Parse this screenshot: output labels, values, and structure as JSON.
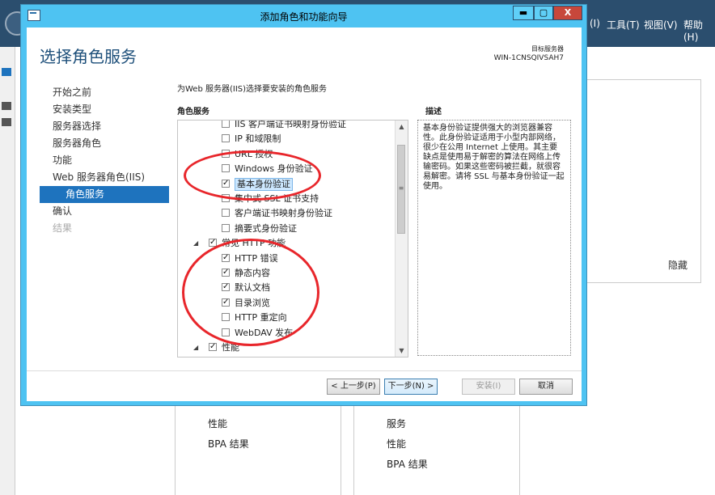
{
  "background": {
    "menu": [
      "(I)",
      "工具(T)",
      "视图(V)",
      "帮助(H)"
    ],
    "hide_label": "隐藏",
    "card1": [
      "性能",
      "BPA 结果"
    ],
    "card2": [
      "服务",
      "性能",
      "BPA 结果"
    ]
  },
  "dialog": {
    "title": "添加角色和功能向导",
    "minimize": "▬",
    "maximize": "▢",
    "close": "X",
    "page_title": "选择角色服务",
    "target_label": "目标服务器",
    "target_name": "WIN-1CNSQIVSAH7",
    "nav": [
      {
        "label": "开始之前",
        "state": "normal"
      },
      {
        "label": "安装类型",
        "state": "normal"
      },
      {
        "label": "服务器选择",
        "state": "normal"
      },
      {
        "label": "服务器角色",
        "state": "normal"
      },
      {
        "label": "功能",
        "state": "normal"
      },
      {
        "label": "Web 服务器角色(IIS)",
        "state": "normal"
      },
      {
        "label": "角色服务",
        "state": "active"
      },
      {
        "label": "确认",
        "state": "normal"
      },
      {
        "label": "结果",
        "state": "disabled"
      }
    ],
    "instruction": "为Web 服务器(IIS)选择要安装的角色服务",
    "roles_header": "角色服务",
    "desc_header": "描述",
    "tree": [
      {
        "label": "IIS 客户端证书映射身份验证",
        "checked": false,
        "indent": 2
      },
      {
        "label": "IP 和域限制",
        "checked": false,
        "indent": 2
      },
      {
        "label": "URL 授权",
        "checked": false,
        "indent": 2
      },
      {
        "label": "Windows 身份验证",
        "checked": false,
        "indent": 2
      },
      {
        "label": "基本身份验证",
        "checked": true,
        "indent": 2,
        "selected": true
      },
      {
        "label": "集中式 SSL 证书支持",
        "checked": false,
        "indent": 2
      },
      {
        "label": "客户端证书映射身份验证",
        "checked": false,
        "indent": 2
      },
      {
        "label": "摘要式身份验证",
        "checked": false,
        "indent": 2
      },
      {
        "label": "常见 HTTP 功能",
        "checked": true,
        "indent": 1,
        "expander": "◢"
      },
      {
        "label": "HTTP 错误",
        "checked": true,
        "indent": 2
      },
      {
        "label": "静态内容",
        "checked": true,
        "indent": 2
      },
      {
        "label": "默认文档",
        "checked": true,
        "indent": 2
      },
      {
        "label": "目录浏览",
        "checked": true,
        "indent": 2
      },
      {
        "label": "HTTP 重定向",
        "checked": false,
        "indent": 2
      },
      {
        "label": "WebDAV 发布",
        "checked": false,
        "indent": 2
      },
      {
        "label": "性能",
        "checked": true,
        "indent": 1,
        "expander": "◢"
      }
    ],
    "scroll_up": "▲",
    "scroll_down": "▼",
    "thumb_grip": "≡",
    "description": "基本身份验证提供强大的浏览器兼容性。此身份验证适用于小型内部网络，很少在公用 Internet 上使用。其主要缺点是使用易于解密的算法在网络上传输密码。如果这些密码被拦截，就很容易解密。请将 SSL 与基本身份验证一起使用。",
    "buttons": {
      "prev": "< 上一步(P)",
      "next": "下一步(N) >",
      "install": "安装(I)",
      "cancel": "取消"
    }
  }
}
